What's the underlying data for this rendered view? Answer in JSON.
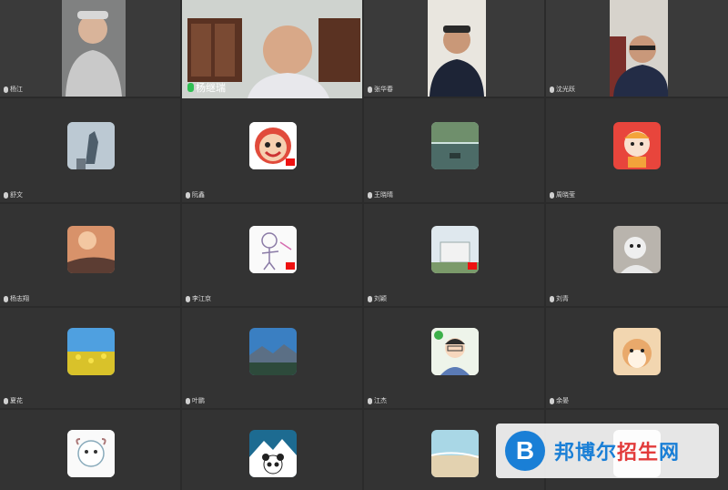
{
  "participants": [
    {
      "name": "杨江",
      "kind": "video"
    },
    {
      "name": "杨继瑞",
      "kind": "video",
      "active": true
    },
    {
      "name": "张华春",
      "kind": "video"
    },
    {
      "name": "沈光跃",
      "kind": "video"
    },
    {
      "name": "舒文",
      "kind": "avatar",
      "avatar_icon": "statue-photo-avatar"
    },
    {
      "name": "阮鑫",
      "kind": "avatar",
      "avatar_icon": "cartoon-face-avatar"
    },
    {
      "name": "王晓晴",
      "kind": "avatar",
      "avatar_icon": "canal-photo-avatar"
    },
    {
      "name": "周晓莹",
      "kind": "avatar",
      "avatar_icon": "tiger-cartoon-avatar"
    },
    {
      "name": "杨志翔",
      "kind": "avatar",
      "avatar_icon": "sunset-planet-avatar"
    },
    {
      "name": "李江京",
      "kind": "avatar",
      "avatar_icon": "child-drawing-avatar"
    },
    {
      "name": "刘颖",
      "kind": "avatar",
      "avatar_icon": "building-photo-avatar"
    },
    {
      "name": "刘青",
      "kind": "avatar",
      "avatar_icon": "dog-photo-avatar"
    },
    {
      "name": "夏花",
      "kind": "avatar",
      "avatar_icon": "flower-field-avatar"
    },
    {
      "name": "叶鹏",
      "kind": "avatar",
      "avatar_icon": "mountain-avatar"
    },
    {
      "name": "江杰",
      "kind": "avatar",
      "avatar_icon": "cartoon-man-avatar"
    },
    {
      "name": "余晏",
      "kind": "avatar",
      "avatar_icon": "shiba-dog-avatar"
    },
    {
      "name": "",
      "kind": "avatar",
      "avatar_icon": "sheep-cartoon-avatar"
    },
    {
      "name": "",
      "kind": "avatar",
      "avatar_icon": "panda-mountain-avatar"
    },
    {
      "name": "",
      "kind": "avatar",
      "avatar_icon": "beach-photo-avatar"
    },
    {
      "name": "",
      "kind": "avatar",
      "avatar_icon": "hidden-avatar"
    }
  ],
  "watermark": {
    "logo_letter": "B",
    "text_blue": "邦博尔",
    "text_red": "招生",
    "text_tail": "网"
  }
}
